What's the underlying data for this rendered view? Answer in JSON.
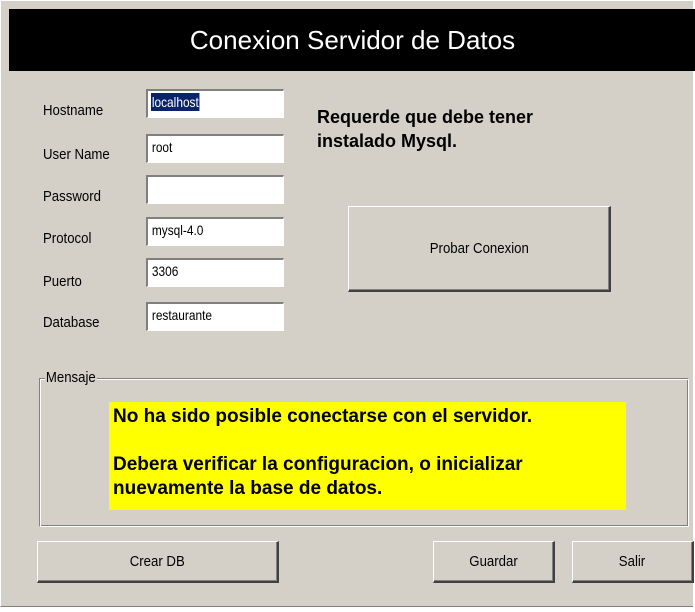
{
  "window": {
    "title": "Conexion Servidor de Datos"
  },
  "form": {
    "fields": [
      {
        "label": "Hostname",
        "value": "localhost",
        "selected": true
      },
      {
        "label": "User Name",
        "value": "root"
      },
      {
        "label": "Password",
        "value": ""
      },
      {
        "label": "Protocol",
        "value": "mysql-4.0"
      },
      {
        "label": "Puerto",
        "value": "3306"
      },
      {
        "label": "Database",
        "value": "restaurante"
      }
    ]
  },
  "info": {
    "line1": "Requerde que debe tener",
    "line2": "instalado Mysql."
  },
  "buttons": {
    "test": "Probar Conexion",
    "create_db": "Crear DB",
    "save": "Guardar",
    "exit": "Salir"
  },
  "message_group": {
    "legend": "Mensaje",
    "line1": "No ha sido posible conectarse con el servidor.",
    "line2": "Debera verificar la configuracion, o inicializar",
    "line3": "nuevamente la base de datos."
  },
  "colors": {
    "dialog_bg": "#d4d0c8",
    "titlebar_bg": "#000000",
    "message_bg": "#ffff00",
    "selection": "#0a246a"
  }
}
